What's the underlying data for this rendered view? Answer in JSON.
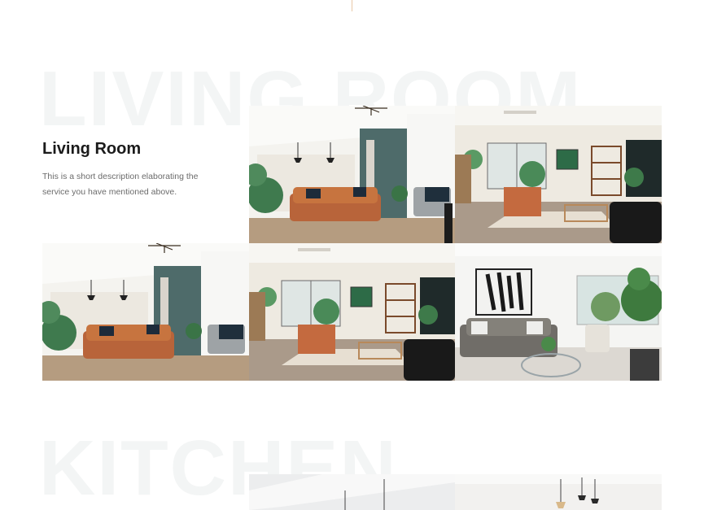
{
  "sections": {
    "living": {
      "bg_title": "LIVING ROOM",
      "heading": "Living Room",
      "description": "This is a short description elaborating the service you have mentioned above."
    },
    "kitchen": {
      "bg_title": "KITCHEN"
    }
  },
  "gallery": {
    "living_photos": [
      {
        "scene": "teal-wall-living-room-photo"
      },
      {
        "scene": "bright-living-room-photo"
      },
      {
        "scene": "teal-wall-living-room-photo"
      },
      {
        "scene": "bright-living-room-photo"
      },
      {
        "scene": "gray-sofa-living-room-photo"
      }
    ],
    "kitchen_photos": [
      {
        "scene": "kitchen-pendant-lights-photo"
      },
      {
        "scene": "kitchen-pendant-lights-photo"
      }
    ]
  },
  "colors": {
    "accent_line": "#e8c9a8",
    "bg_title": "#f3f5f5",
    "heading": "#1b1b1b",
    "body_text": "#6b6b6b"
  }
}
